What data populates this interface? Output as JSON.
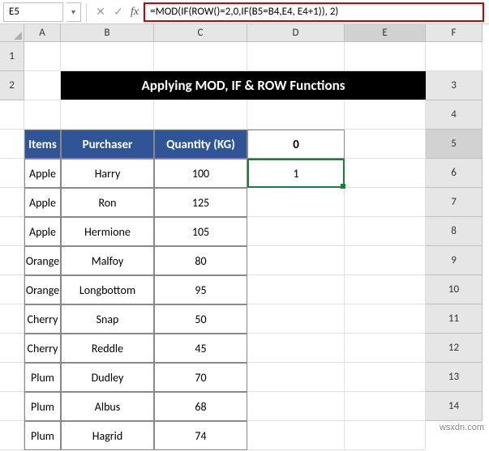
{
  "namebox": {
    "value": "E5"
  },
  "formula": "=MOD(IF(ROW()=2,0,IF(B5=B4,E4, E4+1)), 2)",
  "columns": [
    "A",
    "B",
    "C",
    "D",
    "E",
    "F"
  ],
  "selected_col": "E",
  "rows": [
    "1",
    "2",
    "3",
    "4",
    "5",
    "6",
    "7",
    "8",
    "9",
    "10",
    "11",
    "12",
    "13",
    "14"
  ],
  "selected_row": "5",
  "title": "Applying MOD, IF & ROW Functions",
  "table": {
    "headers": [
      "Items",
      "Purchaser",
      "Quantity (KG)"
    ],
    "e4": "0",
    "e5": "1",
    "data": [
      [
        "Apple",
        "Harry",
        "100"
      ],
      [
        "Apple",
        "Ron",
        "125"
      ],
      [
        "Apple",
        "Hermione",
        "105"
      ],
      [
        "Orange",
        "Malfoy",
        "80"
      ],
      [
        "Orange",
        "Longbottom",
        "95"
      ],
      [
        "Cherry",
        "Snap",
        "50"
      ],
      [
        "Cherry",
        "Reddle",
        "45"
      ],
      [
        "Plum",
        "Dudley",
        "70"
      ],
      [
        "Plum",
        "Albus",
        "68"
      ],
      [
        "Plum",
        "Hagrid",
        "74"
      ]
    ]
  },
  "watermark": "wsxdn.com",
  "icons": {
    "dropdown": "▾",
    "cancel": "✕",
    "enter": "✓"
  }
}
